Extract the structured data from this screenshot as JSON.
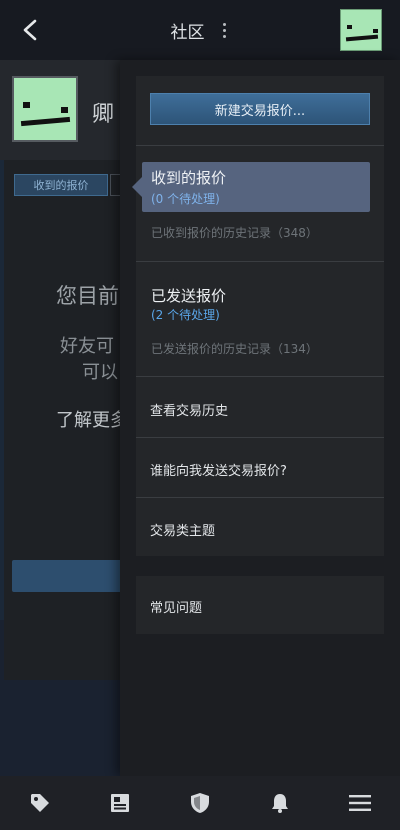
{
  "header": {
    "title": "社区"
  },
  "profile": {
    "name_partial": "卿"
  },
  "background_page": {
    "tab_received": "收到的报价",
    "empty_title": "您目前",
    "empty_sub_line1": "好友可",
    "empty_sub_line2": "可以",
    "learn_more": "了解更多"
  },
  "drawer": {
    "new_offer": "新建交易报价...",
    "received": {
      "title": "收到的报价",
      "pending": "(0 个待处理)",
      "history": "已收到报价的历史记录（348）"
    },
    "sent": {
      "title": "已发送报价",
      "pending": "(2 个待处理)",
      "history": "已发送报价的历史记录（134）"
    },
    "links": [
      "查看交易历史",
      "谁能向我发送交易报价?",
      "交易类主题"
    ],
    "faq": "常见问题"
  },
  "colors": {
    "avatar_green": "#a8e6b5",
    "accent_blue": "#5aa6e8",
    "selected_bg": "#56647f"
  },
  "bottom_nav": {
    "icons": [
      "tag-icon",
      "news-icon",
      "shield-icon",
      "bell-icon",
      "menu-icon"
    ]
  }
}
